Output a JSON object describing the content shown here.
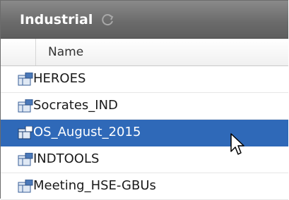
{
  "panel": {
    "title": "Industrial",
    "refresh_icon": "refresh-icon",
    "column_header": "Name"
  },
  "rows": [
    {
      "label": "HEROES",
      "icon": "database-table-icon",
      "selected": false
    },
    {
      "label": "Socrates_IND",
      "icon": "database-table-icon",
      "selected": false
    },
    {
      "label": "OS_August_2015",
      "icon": "database-table-icon",
      "selected": true
    },
    {
      "label": "INDTOOLS",
      "icon": "database-table-icon",
      "selected": false
    },
    {
      "label": "Meeting_HSE-GBUs",
      "icon": "database-table-icon",
      "selected": false
    }
  ],
  "colors": {
    "title_bar": "#6a6a6a",
    "selection": "#2f69b8"
  },
  "cursor_icon": "mouse-pointer-icon"
}
